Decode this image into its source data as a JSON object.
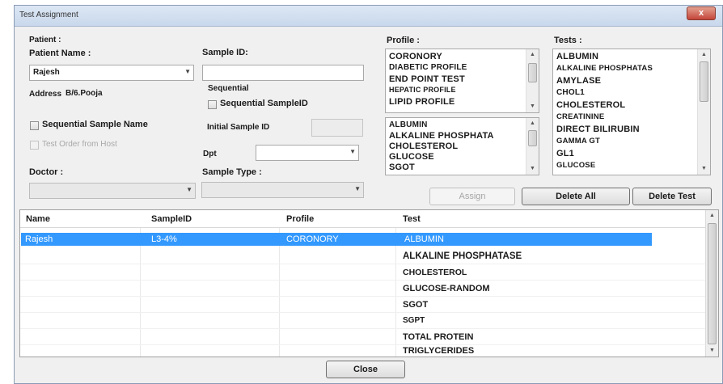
{
  "window": {
    "title": "Test Assignment",
    "close_glyph": "x"
  },
  "patient": {
    "section_label": "Patient :",
    "name_label": "Patient Name :",
    "name_value": "Rajesh",
    "address_label": "Address",
    "address_value": "B/6.Pooja"
  },
  "sample": {
    "id_label": "Sample ID:",
    "id_value": "",
    "sequential_label": "Sequential",
    "sequential_sampleid_label": "Sequential SampleID",
    "initial_sample_label": "Initial Sample ID"
  },
  "options": {
    "sequential_sample_name_label": "Sequential Sample Name",
    "test_order_label": "Test Order from Host"
  },
  "dpt": {
    "label": "Dpt"
  },
  "doctor": {
    "label": "Doctor :"
  },
  "sample_type": {
    "label": "Sample Type :"
  },
  "profile": {
    "label": "Profile :",
    "items": [
      "CORONORY",
      "DIABETIC PROFILE",
      "END POINT TEST",
      "HEPATIC PROFILE",
      "LIPID PROFILE"
    ]
  },
  "profile_tests": {
    "items": [
      "ALBUMIN",
      "ALKALINE PHOSPHATA",
      "CHOLESTEROL",
      "GLUCOSE",
      "SGOT"
    ]
  },
  "tests": {
    "label": "Tests :",
    "items": [
      "ALBUMIN",
      "ALKALINE PHOSPHATAS",
      "AMYLASE",
      "CHOL1",
      "CHOLESTEROL",
      "CREATININE",
      "DIRECT BILIRUBIN",
      "GAMMA GT",
      "GL1",
      "GLUCOSE"
    ]
  },
  "buttons": {
    "assign": "Assign",
    "delete_all": "Delete All",
    "delete_test": "Delete Test",
    "close": "Close"
  },
  "grid": {
    "columns": [
      "Name",
      "SampleID",
      "Profile",
      "Test"
    ],
    "rows": [
      {
        "name": "Rajesh",
        "sample_id": "L3-4%",
        "profile": "CORONORY",
        "test": "ALBUMIN"
      },
      {
        "name": "",
        "sample_id": "",
        "profile": "",
        "test": "ALKALINE PHOSPHATASE"
      },
      {
        "name": "",
        "sample_id": "",
        "profile": "",
        "test": "CHOLESTEROL"
      },
      {
        "name": "",
        "sample_id": "",
        "profile": "",
        "test": "GLUCOSE-RANDOM"
      },
      {
        "name": "",
        "sample_id": "",
        "profile": "",
        "test": "SGOT"
      },
      {
        "name": "",
        "sample_id": "",
        "profile": "",
        "test": "SGPT"
      },
      {
        "name": "",
        "sample_id": "",
        "profile": "",
        "test": "TOTAL PROTEIN"
      },
      {
        "name": "",
        "sample_id": "",
        "profile": "",
        "test": "TRIGLYCERIDES"
      }
    ]
  },
  "colors": {
    "selection": "#3399ff",
    "window_bg": "#f0f0f0",
    "close_button": "#c4453a"
  }
}
